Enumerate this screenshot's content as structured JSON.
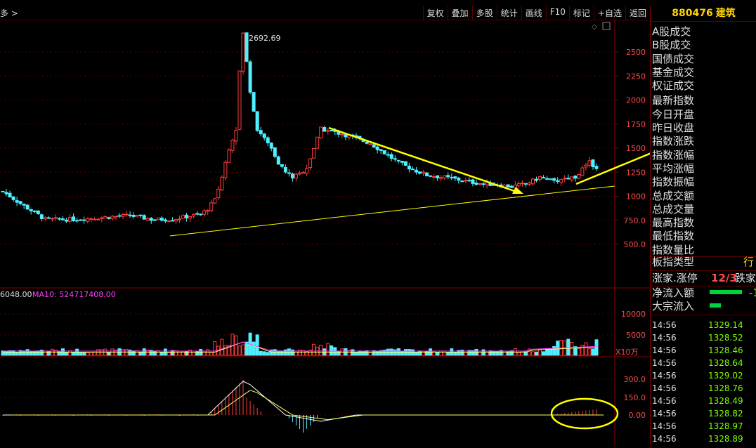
{
  "header": {
    "left_text": "多 >"
  },
  "toolbar": {
    "buttons": [
      "复权",
      "叠加",
      "多股",
      "统计",
      "画线",
      "F10",
      "标记",
      "+自选",
      "返回"
    ]
  },
  "main_chart": {
    "peak_label": "2692.69",
    "y_ticks": [
      "2500",
      "2250",
      "2000",
      "1750",
      "1500",
      "1250",
      "1000",
      "750.0",
      "500.0"
    ],
    "y_values": [
      2500,
      2250,
      2000,
      1750,
      1500,
      1250,
      1000,
      750,
      500
    ],
    "colors": {
      "up": "#ff3c3c",
      "down": "#4ff0ff",
      "trendline": "#ffff00"
    }
  },
  "volume_chart": {
    "label_vol": "6048.00",
    "label_ma": "MA10: 524717408.00",
    "y_ticks": [
      "10000",
      "5000"
    ],
    "unit": "X10万"
  },
  "macd_chart": {
    "y_ticks": [
      "300.0",
      "150.0",
      "0.00"
    ]
  },
  "right_panel": {
    "code": "880476",
    "name": "建筑",
    "items": [
      "A股成交",
      "B股成交",
      "国债成交",
      "基金成交",
      "权证成交",
      "最新指数",
      "今日开盘",
      "昨日收盘",
      "指数涨跌",
      "指数涨幅",
      "平均涨幅",
      "指数振幅",
      "总成交额",
      "总成交量",
      "最高指数",
      "最低指数",
      "指数量比"
    ],
    "type_label": "板指类型",
    "type_value": "行",
    "zt_label": "涨家.涨停",
    "zt_value": "12/3",
    "dj_label": "跌家",
    "inflow_label": "净流入额",
    "inflow_value": "-1",
    "block_label": "大宗流入",
    "ticks": [
      {
        "time": "14:56",
        "price": "1329.14"
      },
      {
        "time": "14:56",
        "price": "1328.52"
      },
      {
        "time": "14:56",
        "price": "1328.46"
      },
      {
        "time": "14:56",
        "price": "1328.64"
      },
      {
        "time": "14:56",
        "price": "1329.02"
      },
      {
        "time": "14:56",
        "price": "1328.76"
      },
      {
        "time": "14:56",
        "price": "1328.49"
      },
      {
        "time": "14:56",
        "price": "1328.82"
      },
      {
        "time": "14:56",
        "price": "1328.97"
      },
      {
        "time": "14:56",
        "price": "1328.89"
      }
    ]
  }
}
